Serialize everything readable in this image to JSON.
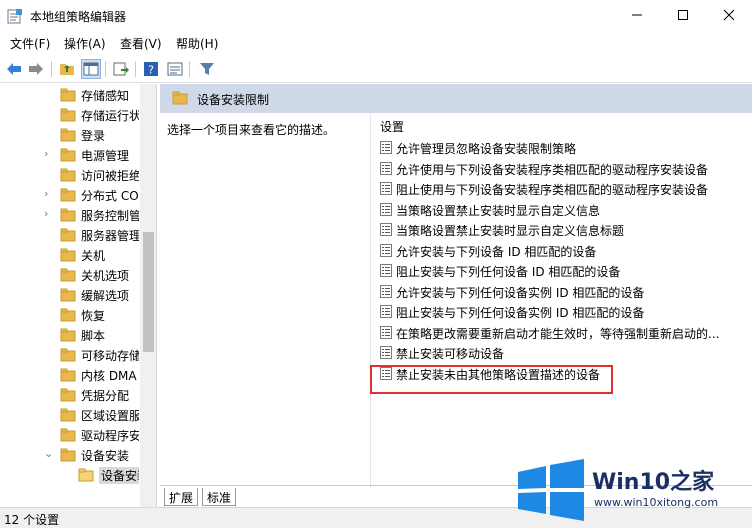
{
  "window": {
    "title": "本地组策略编辑器",
    "minimize_icon": "minimize-icon",
    "maximize_icon": "maximize-icon",
    "close_icon": "close-icon"
  },
  "menu": {
    "items": [
      "文件(F)",
      "操作(A)",
      "查看(V)",
      "帮助(H)"
    ]
  },
  "toolbar": {
    "icons": [
      "back-arrow-icon",
      "forward-arrow-icon",
      "up-folder-icon",
      "show-hide-tree-icon",
      "export-list-icon",
      "help-icon",
      "properties-pane-icon",
      "filter-icon"
    ]
  },
  "tree": {
    "items": [
      {
        "label": "存储感知",
        "expandable": false
      },
      {
        "label": "存储运行状",
        "expandable": false
      },
      {
        "label": "登录",
        "expandable": false
      },
      {
        "label": "电源管理",
        "expandable": true
      },
      {
        "label": "访问被拒绝",
        "expandable": false
      },
      {
        "label": "分布式 COM",
        "expandable": true
      },
      {
        "label": "服务控制管",
        "expandable": true
      },
      {
        "label": "服务器管理",
        "expandable": false
      },
      {
        "label": "关机",
        "expandable": false
      },
      {
        "label": "关机选项",
        "expandable": false
      },
      {
        "label": "缓解选项",
        "expandable": false
      },
      {
        "label": "恢复",
        "expandable": false
      },
      {
        "label": "脚本",
        "expandable": false
      },
      {
        "label": "可移动存储",
        "expandable": false
      },
      {
        "label": "内核 DMA",
        "expandable": false
      },
      {
        "label": "凭据分配",
        "expandable": false
      },
      {
        "label": "区域设置服",
        "expandable": false
      },
      {
        "label": "驱动程序安",
        "expandable": false
      },
      {
        "label": "设备安装",
        "expandable": true,
        "expanded": true
      }
    ],
    "selected_child": "设备安装"
  },
  "header": {
    "title": "设备安装限制"
  },
  "description": "选择一个项目来查看它的描述。",
  "settings": {
    "column_header": "设置",
    "items": [
      "允许管理员忽略设备安装限制策略",
      "允许使用与下列设备安装程序类相匹配的驱动程序安装设备",
      "阻止使用与下列设备安装程序类相匹配的驱动程序安装设备",
      "当策略设置禁止安装时显示自定义信息",
      "当策略设置禁止安装时显示自定义信息标题",
      "允许安装与下列设备 ID 相匹配的设备",
      "阻止安装与下列任何设备 ID 相匹配的设备",
      "允许安装与下列任何设备实例 ID 相匹配的设备",
      "阻止安装与下列任何设备实例 ID 相匹配的设备",
      "在策略更改需要重新启动才能生效时，等待强制重新启动的...",
      "禁止安装可移动设备",
      "禁止安装未由其他策略设置描述的设备"
    ]
  },
  "tabs": [
    "扩展",
    "标准"
  ],
  "status": "12 个设置",
  "watermark": {
    "brand": "Win10之家",
    "url": "www.win10xitong.com"
  },
  "colors": {
    "header_bg": "#cfd9e8",
    "highlight_border": "#e03030",
    "folder_yellow": "#e8b84a",
    "brand_blue": "#1b2f66"
  }
}
